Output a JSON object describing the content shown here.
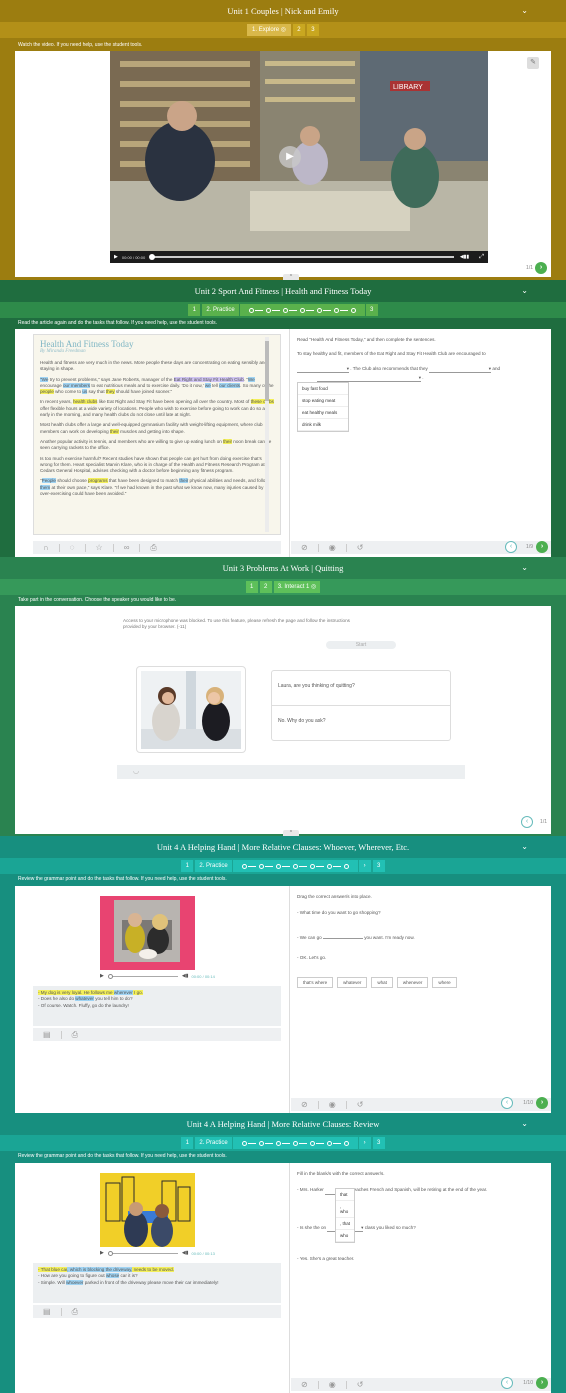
{
  "colors": {
    "gold": "#9c7d10",
    "gold_light": "#c9a720",
    "green_dark": "#1f6d3f",
    "green_mid": "#2e8b57",
    "green_light": "#5ab14c",
    "teal_dark": "#178f7f",
    "teal_light": "#19b8b0"
  },
  "panel1": {
    "title": "Unit 1 Couples | Nick and Emily",
    "step_active": "1. Explore",
    "step2": "2",
    "step3": "3",
    "instruction": "Watch the video. If you need help, use the student tools.",
    "video_time": "00:00 / 00:00",
    "page": "1/1",
    "library_sign": "LIBRARY"
  },
  "panel2": {
    "title": "Unit 2 Sport And Fitness | Health and Fitness Today",
    "step1": "1",
    "step_active": "2. Practice",
    "step3": "3",
    "instruction": "Read the article again and do the tasks that follow. If you need help, use the student tools.",
    "article_title": "Health And Fitness Today",
    "byline": "By Miranda Freedman",
    "p1": "Health and fitness are very much in the news. More people these days are concentrating on eating sensibly and staying in shape.",
    "p2a": "\"We",
    "p2b": " try to prevent problems,\" says Jane Roberts, manager of the ",
    "p2c": "Eat Right and Stay Fit Health Club",
    "p2d": ". \"",
    "p2e": "We",
    "p2f": " encourage ",
    "p2g": "our members",
    "p2h": " to eat nutritious meals and to exercise daily. 'Do it now,' ",
    "p2i": "we",
    "p2j": " tell ",
    "p2k": "our clients",
    "p2l": ". So many of the ",
    "p2m": "people",
    "p2n": " who come to ",
    "p2o": "us",
    "p2p": " say that ",
    "p2q": "they",
    "p2r": " should have joined sooner.\"",
    "p3a": "In recent years, ",
    "p3b": "health clubs",
    "p3c": " like Eat Right and Stay Fit have been opening all over the country. Most of ",
    "p3d": "these clubs",
    "p3e": " offer flexible hours at a wide variety of locations. People who wish to exercise before going to work can do so as early in the morning, and many health clubs do not close until late at night.",
    "p4a": "Most health clubs offer a large and well-equipped gymnasium facility with weight-lifting equipment, where club members can work on developing ",
    "p4b": "their",
    "p4c": " muscles and getting into shape.",
    "p5a": "Another popular activity is tennis, and members who are willing to give up eating lunch on ",
    "p5b": "their",
    "p5c": " noon break can be seen carrying rackets to the office.",
    "p6": "Is too much exercise harmful? Recent studies have shown that people can get hurt from doing exercise that's wrong for them. Heart specialist Marvin Klare, who is in charge of the Health and Fitness Research Program at Cedars General Hospital, advises checking with a doctor before beginning any fitness program.",
    "p7a": "\"",
    "p7b": "People",
    "p7c": " should choose ",
    "p7d": "programs",
    "p7e": " that have been designed to match ",
    "p7f": "their",
    "p7g": " physical abilities and needs, and follow ",
    "p7h": "them",
    "p7i": " at their own pace,\" says Klare. \"If we had known in the past what we know now, many injuries caused by over-exercising could have been avoided.\"",
    "task_intro": "Read \"Health And Fitness Today,\" and then complete the sentences.",
    "task_line1": "To stay healthy and fit, members of the Eat Right and Stay Fit Health Club are encouraged to",
    "task_mid": ". The Club also recommends that they",
    "task_and": "and",
    "options": [
      "buy fast food",
      "stop eating meat",
      "eat healthy meals",
      "drink milk"
    ],
    "page": "1/9"
  },
  "panel3": {
    "title": "Unit 3 Problems At Work | Quitting",
    "step1": "1",
    "step2": "2",
    "step_active": "3. Interact 1",
    "instruction": "Take part in the conversation. Choose the speaker you would like to be.",
    "mic_msg": "Access to your microphone was blocked. To use this feature, please refresh the page and follow the instructions provided by your browser. (-11)",
    "start": "Start",
    "line1": "Laura, are you thinking of quitting?",
    "line2": "No. Why do you ask?",
    "page": "1/1"
  },
  "panel4": {
    "title": "Unit 4 A Helping Hand | More Relative Clauses: Whoever, Wherever, Etc.",
    "step1": "1",
    "step_active": "2. Practice",
    "step3": "3",
    "instruction": "Review the grammar point and do the tasks that follow. If you need help, use the student tools.",
    "time": "00:00 / 00:14",
    "t1a": "- My dog is very loyal. He follows me ",
    "t1b": "wherever",
    "t1c": " I go.",
    "t2a": "- Does he also do ",
    "t2b": "whatever",
    "t2c": " you tell him to do?",
    "t3": "- Of course. Watch. Fluffy, go do the laundry!",
    "drag_intro": "Drag the correct answer/s into place.",
    "q1": "- What time do you want to go shopping?",
    "q2a": "- We can go",
    "q2b": "you want. I'm ready now.",
    "q3": "- OK. Let's go.",
    "options": [
      "that's where",
      "whatever",
      "what",
      "whenever",
      "where"
    ],
    "page": "1/10"
  },
  "panel5": {
    "title": "Unit 4 A Helping Hand | More Relative Clauses: Review",
    "step1": "1",
    "step_active": "2. Practice",
    "step3": "3",
    "instruction": "Review the grammar point and do the tasks that follow. If you need help, use the student tools.",
    "time": "00:00 / 00:13",
    "t1a": "- That blue car",
    "t1b": ", which is blocking the driveway,",
    "t1c": " needs to be moved.",
    "t2a": "- How are you going to figure out ",
    "t2b": "whose",
    "t2c": " car it is?",
    "t3a": "- Simple. Will ",
    "t3b": "whoever",
    "t3c": " parked in front of the driveway please move their car immediately!",
    "fill_intro": "Fill in the blank/s with the correct answer/s.",
    "q1a": "- Mrs. Harker",
    "q1b": "teaches French and Spanish, will be retiring at the end of the year.",
    "q2a": "- Is she the on",
    "q2b": "class you liked so much?",
    "q3": "- Yes. She's a great teacher.",
    "options": [
      "that",
      ", who",
      ", that",
      "who"
    ],
    "page": "1/10"
  }
}
